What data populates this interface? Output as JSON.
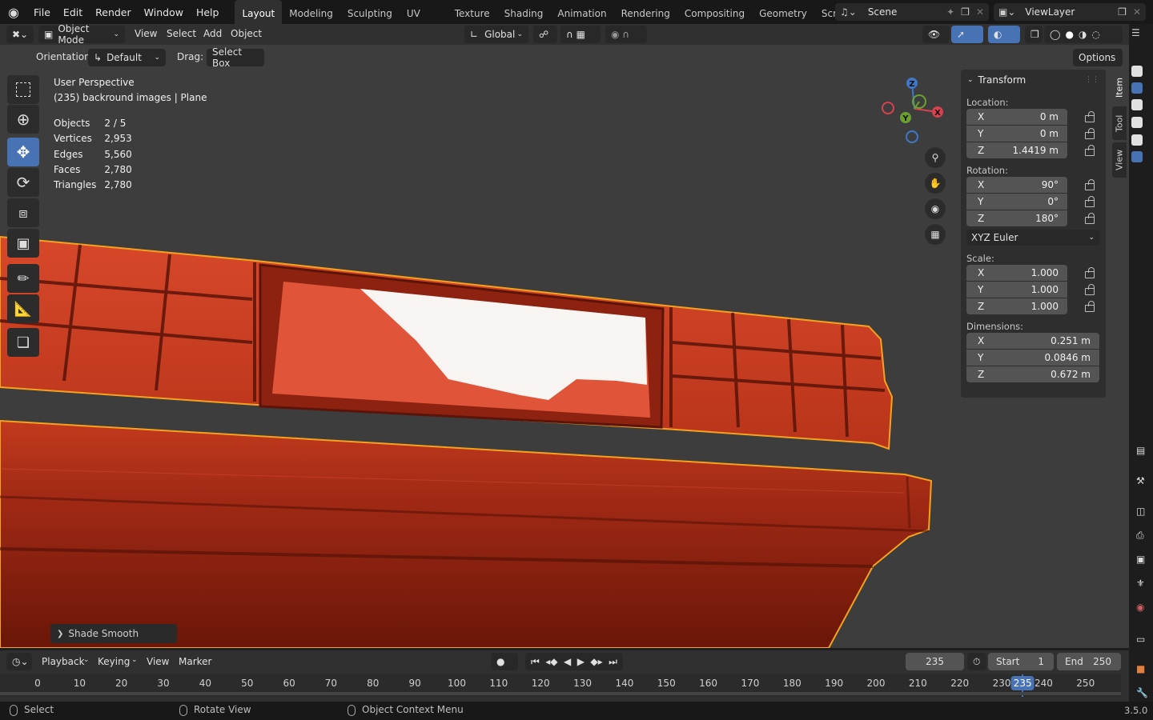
{
  "topbar": {
    "menus": [
      "File",
      "Edit",
      "Render",
      "Window",
      "Help"
    ],
    "workspaces": [
      "Layout",
      "Modeling",
      "Sculpting",
      "UV Editing",
      "Texture Paint",
      "Shading",
      "Animation",
      "Rendering",
      "Compositing",
      "Geometry Nodes",
      "Scripting"
    ],
    "active_workspace": "Layout",
    "scene": "Scene",
    "view_layer": "ViewLayer"
  },
  "header": {
    "mode": "Object Mode",
    "menus": [
      "View",
      "Select",
      "Add",
      "Object"
    ],
    "transform_orientation": "Global",
    "options": "Options"
  },
  "tool_settings": {
    "orientation_label": "Orientation:",
    "orientation_value": "Default",
    "drag_label": "Drag:",
    "drag_value": "Select Box"
  },
  "overlay": {
    "perspective": "User Perspective",
    "object_info": "(235) backround images | Plane",
    "stats": [
      {
        "label": "Objects",
        "value": "2 / 5"
      },
      {
        "label": "Vertices",
        "value": "2,953"
      },
      {
        "label": "Edges",
        "value": "5,560"
      },
      {
        "label": "Faces",
        "value": "2,780"
      },
      {
        "label": "Triangles",
        "value": "2,780"
      }
    ]
  },
  "gizmo": {
    "x": "X",
    "y": "Y",
    "z": "Z"
  },
  "npanel": {
    "title": "Transform",
    "location_label": "Location:",
    "location": [
      {
        "axis": "X",
        "value": "0 m"
      },
      {
        "axis": "Y",
        "value": "0 m"
      },
      {
        "axis": "Z",
        "value": "1.4419 m"
      }
    ],
    "rotation_label": "Rotation:",
    "rotation": [
      {
        "axis": "X",
        "value": "90°"
      },
      {
        "axis": "Y",
        "value": "0°"
      },
      {
        "axis": "Z",
        "value": "180°"
      }
    ],
    "rotation_mode": "XYZ Euler",
    "scale_label": "Scale:",
    "scale": [
      {
        "axis": "X",
        "value": "1.000"
      },
      {
        "axis": "Y",
        "value": "1.000"
      },
      {
        "axis": "Z",
        "value": "1.000"
      }
    ],
    "dimensions_label": "Dimensions:",
    "dimensions": [
      {
        "axis": "X",
        "value": "0.251 m"
      },
      {
        "axis": "Y",
        "value": "0.0846 m"
      },
      {
        "axis": "Z",
        "value": "0.672 m"
      }
    ],
    "tabs": [
      "Item",
      "Tool",
      "View"
    ]
  },
  "last_operator": "Shade Smooth",
  "timeline": {
    "menus": [
      "Playback",
      "Keying",
      "View",
      "Marker"
    ],
    "current_frame": "235",
    "start_label": "Start",
    "start": "1",
    "end_label": "End",
    "end": "250",
    "ticks": [
      "0",
      "10",
      "20",
      "30",
      "40",
      "50",
      "60",
      "70",
      "80",
      "90",
      "100",
      "110",
      "120",
      "130",
      "140",
      "150",
      "160",
      "170",
      "180",
      "190",
      "200",
      "210",
      "220",
      "230",
      "240",
      "250"
    ]
  },
  "statusbar": {
    "select": "Select",
    "rotate": "Rotate View",
    "context": "Object Context Menu",
    "version": "3.5.0"
  },
  "colors": {
    "accent": "#4772b3",
    "selection_outline": "#f5a21c",
    "object": "#c8391e"
  }
}
